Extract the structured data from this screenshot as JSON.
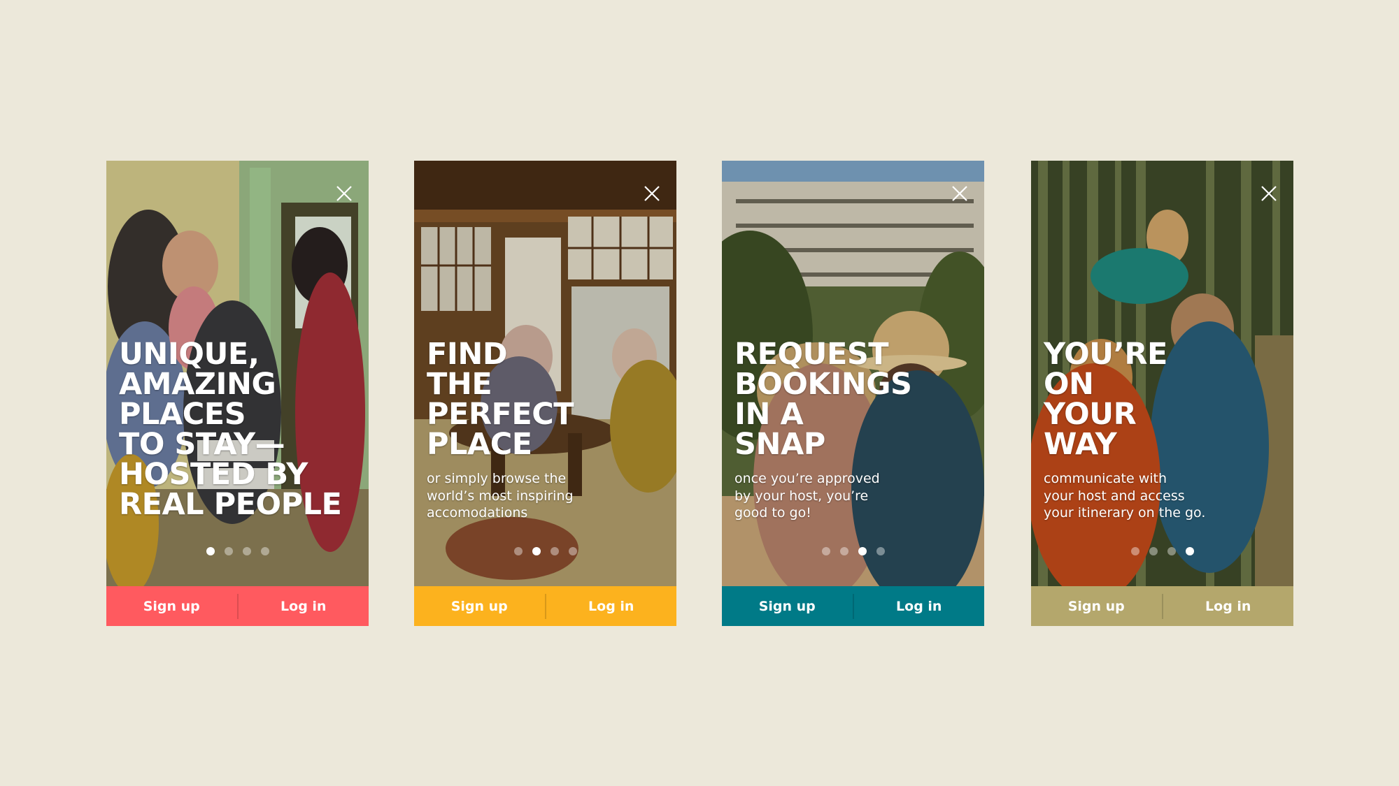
{
  "screens": [
    {
      "headline": "UNIQUE,\nAMAZING\nPLACES\nTO STAY—\nHOSTED BY\nREAL PEOPLE",
      "subtext": "",
      "active_dot": 0,
      "accent": "#ff5a5f",
      "signup_label": "Sign up",
      "login_label": "Log in",
      "close_icon": "close-icon"
    },
    {
      "headline": "FIND\nTHE\nPERFECT\nPLACE",
      "subtext": "or simply browse the\nworld’s most inspiring\naccomodations",
      "active_dot": 1,
      "accent": "#fcb21e",
      "signup_label": "Sign up",
      "login_label": "Log in",
      "close_icon": "close-icon"
    },
    {
      "headline": "REQUEST\nBOOKINGS\nIN A\nSNAP",
      "subtext": "once you’re approved\nby your host, you’re\ngood to go!",
      "active_dot": 2,
      "accent": "#007a87",
      "signup_label": "Sign up",
      "login_label": "Log in",
      "close_icon": "close-icon"
    },
    {
      "headline": "YOU’RE\nON\nYOUR\nWAY",
      "subtext": "communicate with\nyour host and access\nyour itinerary on the go.",
      "active_dot": 3,
      "accent": "#b4a76c",
      "signup_label": "Sign up",
      "login_label": "Log in",
      "close_icon": "close-icon"
    }
  ]
}
